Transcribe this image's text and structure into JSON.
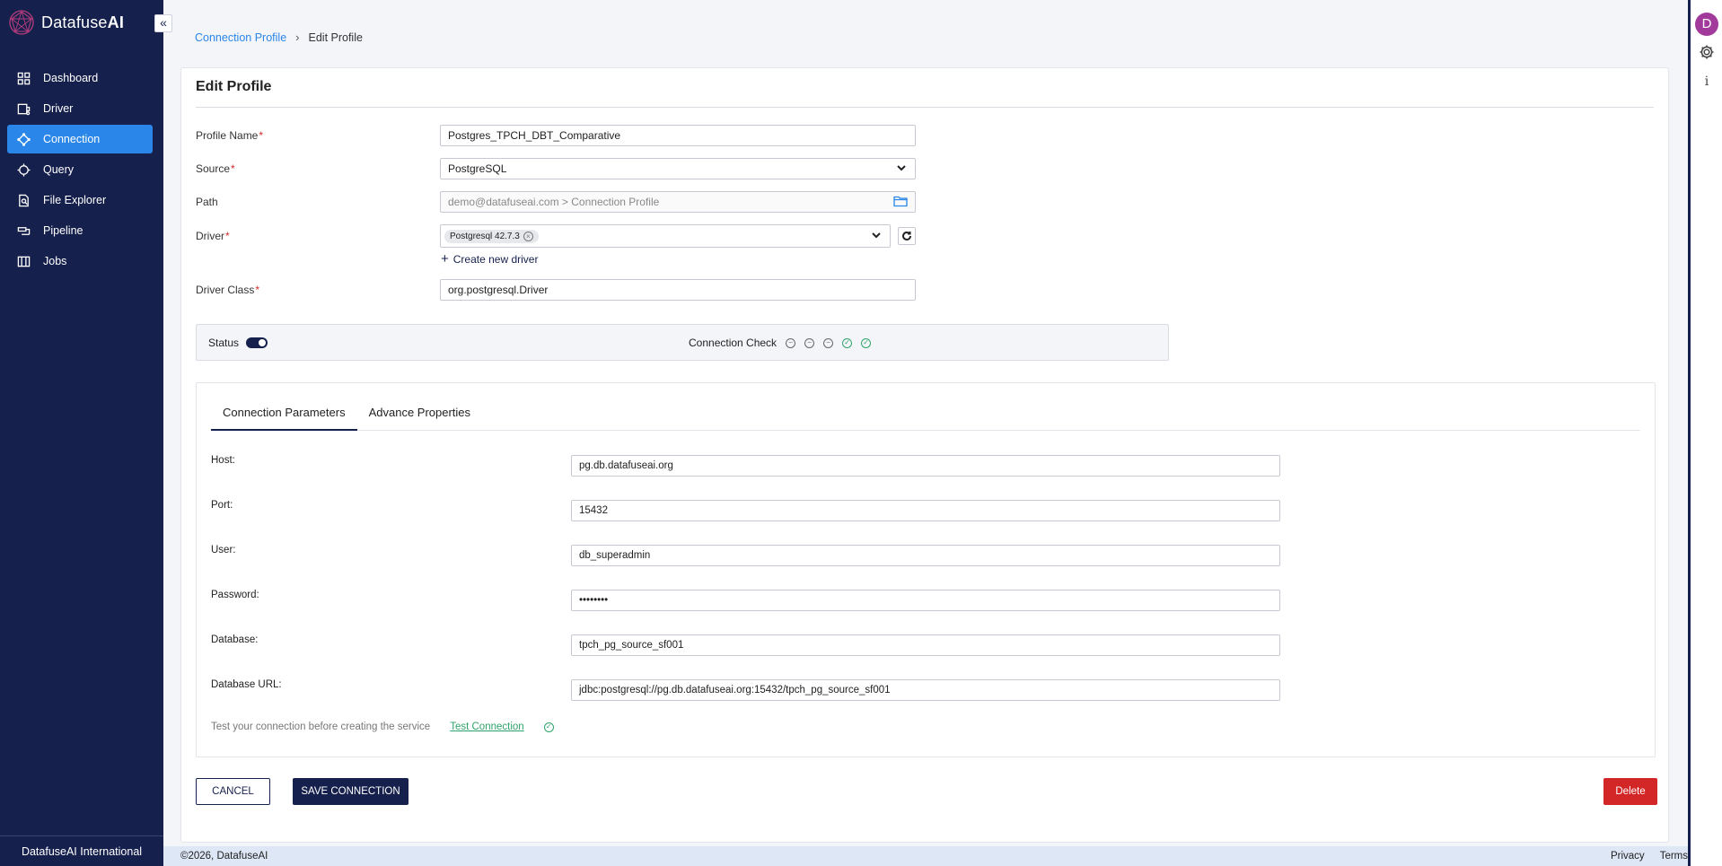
{
  "app": {
    "logo_name": "Datafuse",
    "logo_suffix": "AI",
    "collapse_glyph": "«",
    "brand_color": "#16204d",
    "accent_color": "#2a86e8"
  },
  "sidebar": {
    "items": [
      {
        "label": "Dashboard",
        "icon": "grid-icon",
        "active": false
      },
      {
        "label": "Driver",
        "icon": "driver-icon",
        "active": false
      },
      {
        "label": "Connection",
        "icon": "connection-icon",
        "active": true
      },
      {
        "label": "Query",
        "icon": "query-icon",
        "active": false
      },
      {
        "label": "File Explorer",
        "icon": "file-explorer-icon",
        "active": false
      },
      {
        "label": "Pipeline",
        "icon": "pipeline-icon",
        "active": false
      },
      {
        "label": "Jobs",
        "icon": "jobs-icon",
        "active": false
      }
    ],
    "footer": "DatafuseAI International"
  },
  "rightbar": {
    "avatar_initial": "D",
    "info_glyph": "i"
  },
  "breadcrumb": {
    "parent": "Connection Profile",
    "separator": "›",
    "current": "Edit Profile"
  },
  "form": {
    "title": "Edit Profile",
    "profile_name": {
      "label": "Profile Name",
      "required_mark": "*",
      "value": "Postgres_TPCH_DBT_Comparative"
    },
    "source": {
      "label": "Source",
      "required_mark": "*",
      "value": "PostgreSQL"
    },
    "path": {
      "label": "Path",
      "value": "demo@datafuseai.com > Connection Profile"
    },
    "driver": {
      "label": "Driver",
      "required_mark": "*",
      "chip": "Postgresql 42.7.3",
      "chip_remove": "×",
      "create_label": "Create new driver",
      "create_glyph": "+"
    },
    "driver_class": {
      "label": "Driver Class",
      "required_mark": "*",
      "value": "org.postgresql.Driver"
    }
  },
  "status": {
    "label": "Status",
    "enabled": true,
    "check_label": "Connection Check",
    "check_icons": [
      {
        "icon": "minus-circle-icon",
        "glyph": "−",
        "state": "pending"
      },
      {
        "icon": "minus-circle-icon",
        "glyph": "−",
        "state": "pending"
      },
      {
        "icon": "minus-circle-icon",
        "glyph": "−",
        "state": "pending"
      },
      {
        "icon": "check-circle-icon",
        "glyph": "✓",
        "state": "ok"
      },
      {
        "icon": "check-circle-icon",
        "glyph": "✓",
        "state": "ok"
      }
    ]
  },
  "tabs": [
    {
      "label": "Connection Parameters",
      "active": true
    },
    {
      "label": "Advance Properties",
      "active": false
    }
  ],
  "params": [
    {
      "label": "Host:",
      "value": "pg.db.datafuseai.org"
    },
    {
      "label": "Port:",
      "value": "15432"
    },
    {
      "label": "User:",
      "value": "db_superadmin"
    },
    {
      "label": "Password:",
      "value": "••••••••"
    },
    {
      "label": "Database:",
      "value": "tpch_pg_source_sf001"
    },
    {
      "label": "Database URL:",
      "value": "jdbc:postgresql://pg.db.datafuseai.org:15432/tpch_pg_source_sf001"
    }
  ],
  "test": {
    "hint": "Test your connection before creating the service",
    "link": "Test Connection",
    "ok_glyph": "✓"
  },
  "buttons": {
    "cancel": "CANCEL",
    "save": "SAVE CONNECTION",
    "delete": "Delete"
  },
  "footer": {
    "copyright": "©2026, DatafuseAI",
    "links": [
      "Privacy",
      "Terms"
    ]
  }
}
